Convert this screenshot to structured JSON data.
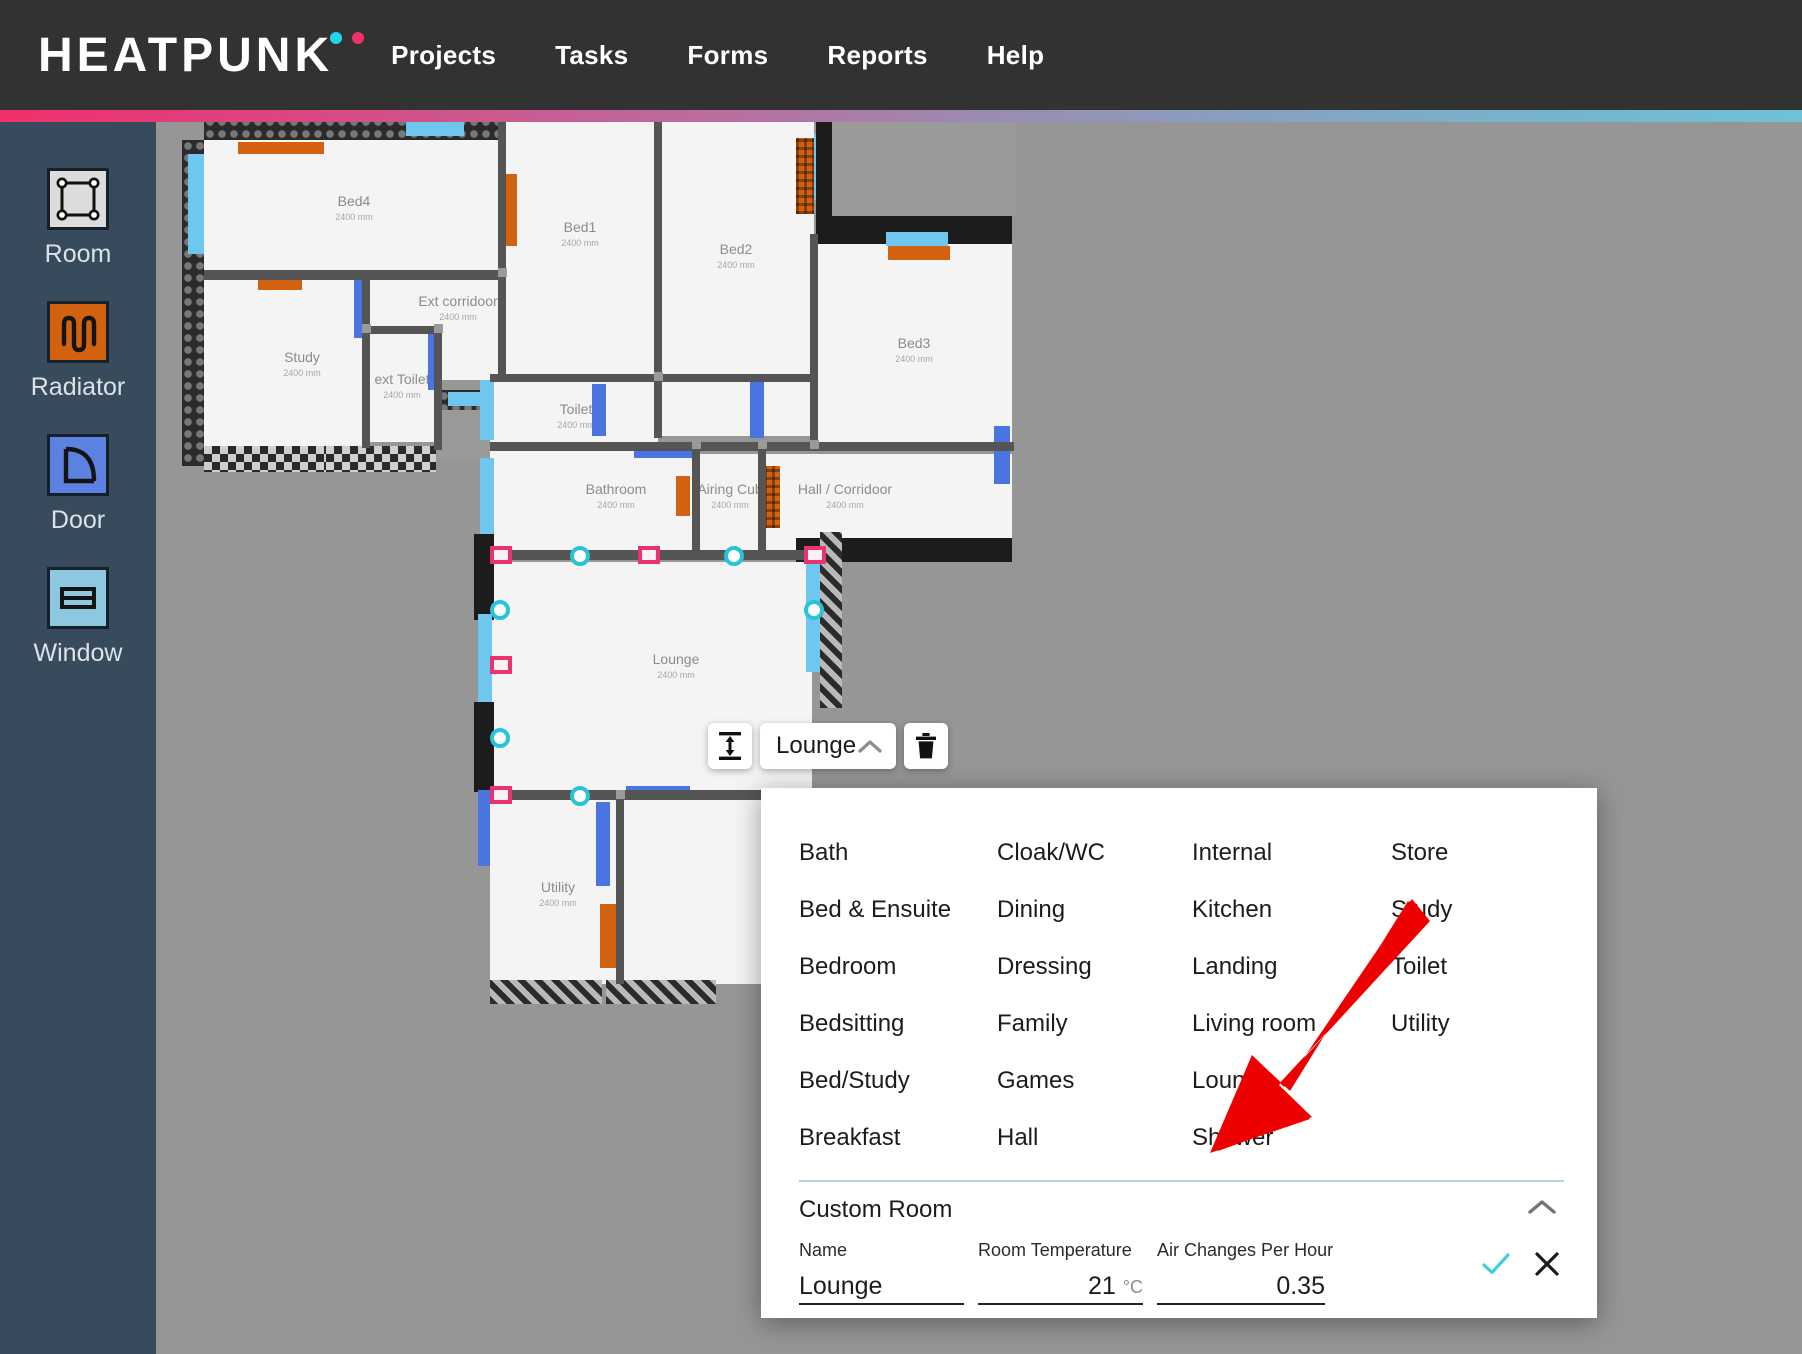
{
  "header": {
    "logo_text": "HEATPUNK",
    "logo_dot_cyan": "#22d3ee",
    "logo_dot_pink": "#f0306b",
    "bg": "#323232",
    "nav": [
      {
        "label": "Projects"
      },
      {
        "label": "Tasks"
      },
      {
        "label": "Forms"
      },
      {
        "label": "Reports"
      },
      {
        "label": "Help"
      }
    ],
    "gradient_from": "#f0306b",
    "gradient_to": "#6ec2d8"
  },
  "sidebar": {
    "bg": "#384b5c",
    "tools": [
      {
        "label": "Room",
        "icon": "room-polygon-icon",
        "color": "#dcdcdc"
      },
      {
        "label": "Radiator",
        "icon": "radiator-coil-icon",
        "color": "#d2620f"
      },
      {
        "label": "Door",
        "icon": "door-swing-icon",
        "color": "#5b82e0"
      },
      {
        "label": "Window",
        "icon": "window-pane-icon",
        "color": "#8ec7e0"
      }
    ]
  },
  "canvas": {
    "bg": "#969696",
    "rooms": [
      {
        "name": "Bed4",
        "dim": "2400 mm"
      },
      {
        "name": "Bed1",
        "dim": "2400 mm"
      },
      {
        "name": "Bed2",
        "dim": "2400 mm"
      },
      {
        "name": "Bed3",
        "dim": "2400 mm"
      },
      {
        "name": "Ext corridoor",
        "dim": "2400 mm"
      },
      {
        "name": "Study",
        "dim": "2400 mm"
      },
      {
        "name": "ext Toilet",
        "dim": "2400 mm"
      },
      {
        "name": "Toilet",
        "dim": "2400 mm"
      },
      {
        "name": "Bathroom",
        "dim": "2400 mm"
      },
      {
        "name": "Airing Cub",
        "dim": "2400 mm"
      },
      {
        "name": "Hall / Corridoor",
        "dim": "2400 mm"
      },
      {
        "name": "Lounge",
        "dim": "2400 mm"
      },
      {
        "name": "Utility",
        "dim": "2400 mm"
      }
    ],
    "selection_handle_square_color": "#e8336d",
    "selection_handle_circle_color": "#27c4d8"
  },
  "floating_toolbar": {
    "height_button_icon": "height-adjust-icon",
    "selected_room": "Lounge",
    "chevron_icon": "chevron-up-icon",
    "delete_button_icon": "trash-icon"
  },
  "room_type_menu": {
    "options": [
      "Bath",
      "Cloak/WC",
      "Internal",
      "Store",
      "Bed & Ensuite",
      "Dining",
      "Kitchen",
      "Study",
      "Bedroom",
      "Dressing",
      "Landing",
      "Toilet",
      "Bedsitting",
      "Family",
      "Living room",
      "Utility",
      "Bed/Study",
      "Games",
      "Lounge",
      "",
      "Breakfast",
      "Hall",
      "Shower",
      ""
    ],
    "custom_section": {
      "title": "Custom Room",
      "collapse_icon": "chevron-up-icon",
      "fields": [
        {
          "label": "Name",
          "value": "Lounge",
          "unit": ""
        },
        {
          "label": "Room Temperature",
          "value": "21",
          "unit": "°C"
        },
        {
          "label": "Air Changes Per Hour",
          "value": "0.35",
          "unit": ""
        }
      ],
      "confirm_icon": "check-icon",
      "confirm_color": "#3fd0e0",
      "cancel_icon": "close-icon"
    }
  },
  "annotation": {
    "arrow_icon": "red-arrow-icon",
    "arrow_color": "#ee0000"
  }
}
